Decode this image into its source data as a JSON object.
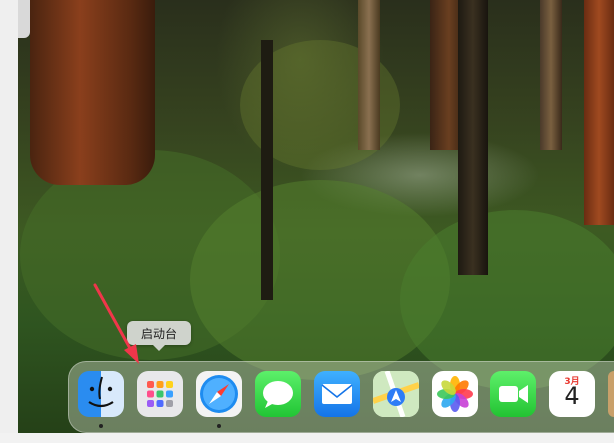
{
  "dock": {
    "tooltip": "启动台",
    "apps": [
      {
        "id": "finder",
        "icon": "finder-icon",
        "running": true
      },
      {
        "id": "launchpad",
        "icon": "launchpad-icon",
        "running": false,
        "hovered": true
      },
      {
        "id": "safari",
        "icon": "safari-icon",
        "running": true
      },
      {
        "id": "messages",
        "icon": "messages-icon",
        "running": false
      },
      {
        "id": "mail",
        "icon": "mail-icon",
        "running": false
      },
      {
        "id": "maps",
        "icon": "maps-icon",
        "running": false
      },
      {
        "id": "photos",
        "icon": "photos-icon",
        "running": false
      },
      {
        "id": "facetime",
        "icon": "facetime-icon",
        "running": false
      },
      {
        "id": "calendar",
        "icon": "calendar-icon",
        "running": false,
        "month": "3月",
        "day": "4"
      }
    ]
  },
  "annotation": {
    "type": "arrow",
    "color": "#f0364a"
  },
  "colors": {
    "arrow": "#f0364a",
    "dock": "#cdd7c3",
    "tooltip_bg": "#cfd3cc"
  }
}
